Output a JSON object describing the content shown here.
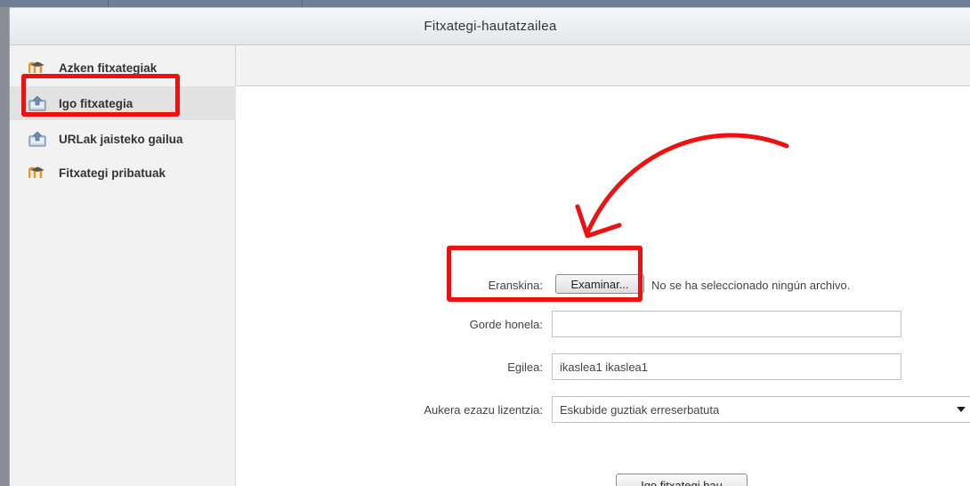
{
  "window": {
    "title": "Fitxategi-hautatzailea"
  },
  "sidebar": {
    "items": [
      {
        "label": "Azken fitxategiak",
        "icon": "moodle-icon"
      },
      {
        "label": "Igo fitxategia",
        "icon": "upload-icon",
        "active": true
      },
      {
        "label": "URLak jaisteko gailua",
        "icon": "url-download-icon"
      },
      {
        "label": "Fitxategi pribatuak",
        "icon": "moodle-icon"
      }
    ]
  },
  "form": {
    "attachment_label": "Eranskina:",
    "browse_button": "Examinar...",
    "no_file_text": "No se ha seleccionado ningún archivo.",
    "save_as_label": "Gorde honela:",
    "save_as_value": "",
    "author_label": "Egilea:",
    "author_value": "ikaslea1 ikaslea1",
    "license_label": "Aukera ezazu lizentzia:",
    "license_value": "Eskubide guztiak erreserbatuta",
    "upload_button": "Igo fitxategi hau"
  },
  "colors": {
    "highlight": "#ee1111",
    "moodle_orange": "#f39419"
  }
}
